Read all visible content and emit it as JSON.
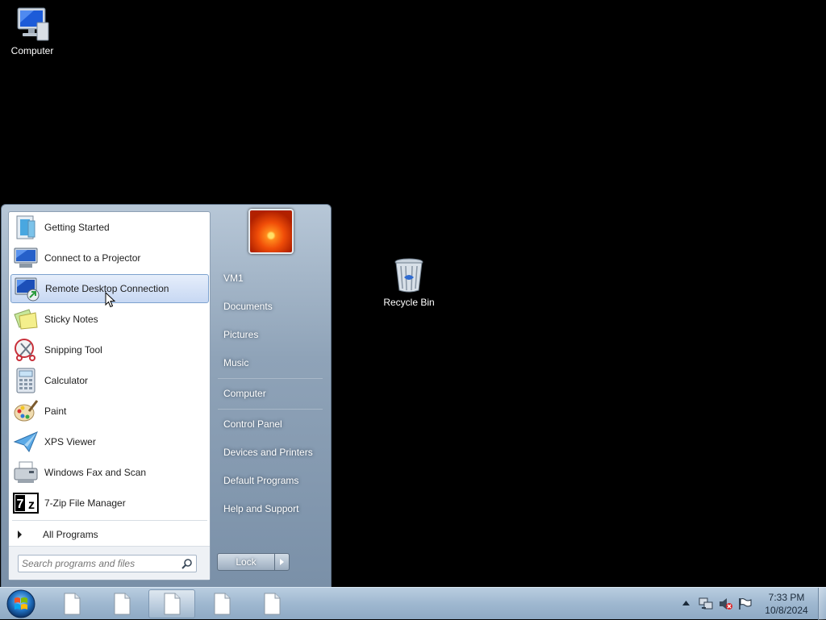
{
  "desktop": {
    "icons": [
      {
        "label": "Computer",
        "icon": "computer-icon"
      },
      {
        "label": "Recycle Bin",
        "icon": "recycle-bin-icon"
      }
    ]
  },
  "start_menu": {
    "programs": [
      {
        "label": "Getting Started",
        "icon": "getting-started-icon"
      },
      {
        "label": "Connect to a Projector",
        "icon": "projector-icon"
      },
      {
        "label": "Remote Desktop Connection",
        "icon": "remote-desktop-icon",
        "selected": true
      },
      {
        "label": "Sticky Notes",
        "icon": "sticky-notes-icon"
      },
      {
        "label": "Snipping Tool",
        "icon": "snipping-tool-icon"
      },
      {
        "label": "Calculator",
        "icon": "calculator-icon"
      },
      {
        "label": "Paint",
        "icon": "paint-icon"
      },
      {
        "label": "XPS Viewer",
        "icon": "xps-viewer-icon"
      },
      {
        "label": "Windows Fax and Scan",
        "icon": "fax-scan-icon"
      },
      {
        "label": "7-Zip File Manager",
        "icon": "seven-zip-icon"
      }
    ],
    "all_programs_label": "All Programs",
    "search_placeholder": "Search programs and files",
    "places": [
      "VM1",
      "Documents",
      "Pictures",
      "Music",
      "Computer",
      "Control Panel",
      "Devices and Printers",
      "Default Programs",
      "Help and Support"
    ],
    "lock_label": "Lock"
  },
  "taskbar": {
    "buttons": [
      "document-icon",
      "document-icon",
      "document-icon",
      "document-icon",
      "document-icon"
    ],
    "active_index": 2,
    "clock": {
      "time": "7:33 PM",
      "date": "10/8/2024"
    }
  },
  "colors": {
    "selection": "#c7d8f3",
    "taskbar": "#9fb8d0"
  }
}
